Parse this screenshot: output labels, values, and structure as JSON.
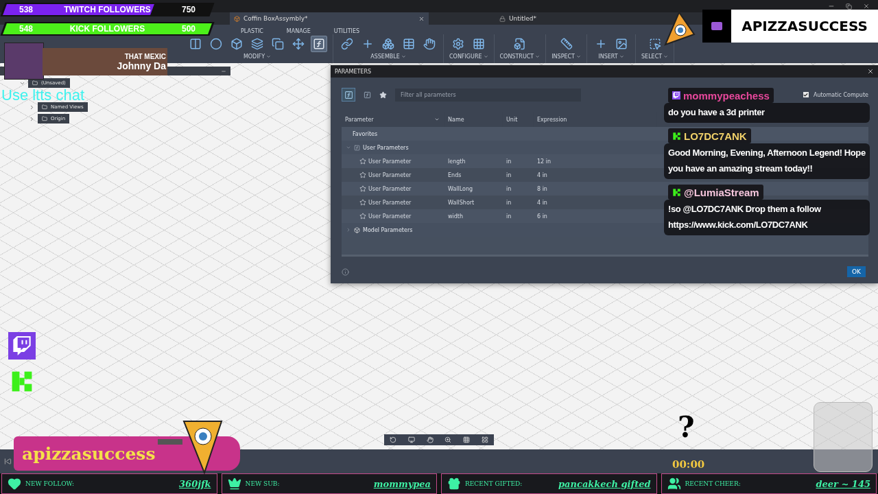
{
  "document_tabs": [
    {
      "label": "Coffin BoxAssymbly*",
      "selected": true
    },
    {
      "label": "Untitled*",
      "selected": false
    }
  ],
  "toolbar": {
    "tabs": [
      {
        "label": "PLASTIC"
      },
      {
        "label": "MANAGE"
      },
      {
        "label": "UTILITIES"
      }
    ],
    "groups": [
      {
        "label": "MODIFY",
        "kind": "modify"
      },
      {
        "label": "ASSEMBLE",
        "kind": "assemble"
      },
      {
        "label": "CONFIGURE",
        "kind": "configure"
      },
      {
        "label": "CONSTRUCT",
        "kind": "construct"
      },
      {
        "label": "INSPECT",
        "kind": "inspect"
      },
      {
        "label": "INSERT",
        "kind": "insert"
      },
      {
        "label": "SELECT",
        "kind": "select"
      }
    ]
  },
  "browser": {
    "items": [
      {
        "label": "(Unsaved)",
        "expanded": true,
        "children": [
          {
            "label": "Named Views",
            "expanded": false
          },
          {
            "label": "Origin",
            "expanded": false
          }
        ]
      }
    ]
  },
  "parameters_dialog": {
    "title": "PARAMETERS",
    "filter": {
      "placeholder": "Filter all parameters"
    },
    "automatic_compute": {
      "label": "Automatic Compute",
      "checked": true
    },
    "columns": [
      "Parameter",
      "Name",
      "Unit",
      "Expression"
    ],
    "sections": [
      {
        "label": "Favorites",
        "kind": "favorites"
      },
      {
        "label": "User Parameters",
        "kind": "user",
        "expanded": true,
        "rows": [
          {
            "parameter": "User Parameter",
            "name": "length",
            "unit": "in",
            "expression": "12 in",
            "favorite": false
          },
          {
            "parameter": "User Parameter",
            "name": "Ends",
            "unit": "in",
            "expression": "4 in",
            "favorite": false
          },
          {
            "parameter": "User Parameter",
            "name": "WallLong",
            "unit": "in",
            "expression": "8 in",
            "favorite": false
          },
          {
            "parameter": "User Parameter",
            "name": "WallShort",
            "unit": "in",
            "expression": "4 in",
            "favorite": false
          },
          {
            "parameter": "User Parameter",
            "name": "width",
            "unit": "in",
            "expression": "6 in",
            "favorite": false
          }
        ]
      },
      {
        "label": "Model Parameters",
        "kind": "model",
        "expanded": false
      }
    ],
    "ok": "OK"
  },
  "stream_overlay": {
    "goals": [
      {
        "count": "538",
        "label": "TWITCH FOLLOWERS",
        "goal": "750",
        "level": 0.72,
        "color": "#7b22f0"
      },
      {
        "count": "548",
        "label": "KICK FOLLOWERS",
        "goal": "500",
        "level": 1,
        "color": "#4cf01a"
      }
    ],
    "webcam": {
      "lines": [
        "THAT MEXIC",
        "Johnny Da"
      ]
    },
    "tts_hint": "Use ltts chat",
    "chat": [
      {
        "user": "mommypeachess",
        "kind": "twitch",
        "color": "#e8489c",
        "text": "do you have a 3d printer"
      },
      {
        "user": "LO7DC7ANK",
        "kind": "kick",
        "color": "#f2d26a",
        "text": "Good Morning, Evening, Afternoon Legend! Hope you have an amazing stream today!!"
      },
      {
        "user": "@LumiaStream",
        "kind": "kick",
        "color": "#f6c6dc",
        "text": "!so @LO7DC7ANK Drop them a follow https://www.kick.com/LO7DC7ANK"
      }
    ],
    "channel_logo": "APIZZASUCCESS",
    "banner": "apizzasuccess",
    "mystery": "?",
    "timer": "00:00",
    "alerts": [
      {
        "kind": "follow",
        "label": "NEW FOLLOW:",
        "value": "360jfk"
      },
      {
        "kind": "sub",
        "label": "NEW SUB:",
        "value": "mommypea"
      },
      {
        "kind": "gift",
        "label": "RECENT GIFTED:",
        "value": "pancakkech gifted"
      },
      {
        "kind": "cheer",
        "label": "RECENT CHEER:",
        "value": "deer ~ 145"
      }
    ]
  }
}
